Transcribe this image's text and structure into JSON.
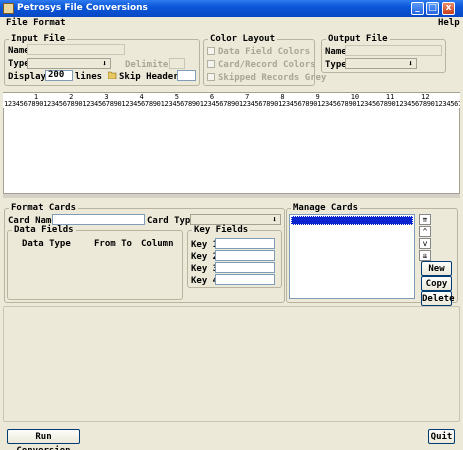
{
  "window": {
    "title": "Petrosys File Conversions",
    "minimize": "_",
    "maximize": "□",
    "close": "x"
  },
  "menu": {
    "file_format": "File Format",
    "help": "Help"
  },
  "input_file": {
    "group_title": "Input File",
    "name_label": "Name",
    "type_label": "Type",
    "delimiter_label": "Delimiter",
    "display_label": "Display",
    "display_value": "200",
    "lines_label": "lines",
    "skip_headers_label": "Skip Headers",
    "skip_headers_value": ""
  },
  "color_layout": {
    "group_title": "Color Layout",
    "options": [
      "Data Field Colors",
      "Card/Record Colors",
      "Skipped Records Grey"
    ]
  },
  "output_file": {
    "group_title": "Output File",
    "name_label": "Name",
    "type_label": "Type"
  },
  "ruler": {
    "tens": [
      "1",
      "2",
      "3",
      "4",
      "5",
      "6",
      "7",
      "8",
      "9",
      "10",
      "11",
      "12"
    ],
    "digits": "1234567890123456789012345678901234567890123456789012345678901234567890123456789012345678901234567890123456789012345678901234567890"
  },
  "format_cards": {
    "group_title": "Format Cards",
    "card_name_label": "Card Name",
    "card_name_value": "",
    "card_type_label": "Card Type",
    "data_fields": {
      "group_title": "Data Fields",
      "columns": [
        "Data Type",
        "From To",
        "Column"
      ]
    },
    "key_fields": {
      "group_title": "Key Fields",
      "keys": [
        "Key 1",
        "Key 2",
        "Key 3",
        "Key 4"
      ]
    }
  },
  "manage_cards": {
    "group_title": "Manage Cards",
    "new_label": "New",
    "copy_label": "Copy",
    "delete_label": "Delete",
    "move_top": "⇈",
    "move_up": "^",
    "move_down": "v",
    "move_bottom": "⇊"
  },
  "footer": {
    "run_label": "Run Conversion",
    "quit_label": "Quit"
  },
  "icons": {
    "dropdown": "down-arrow-icon",
    "folder": "open-folder-icon",
    "app": "app-icon"
  }
}
